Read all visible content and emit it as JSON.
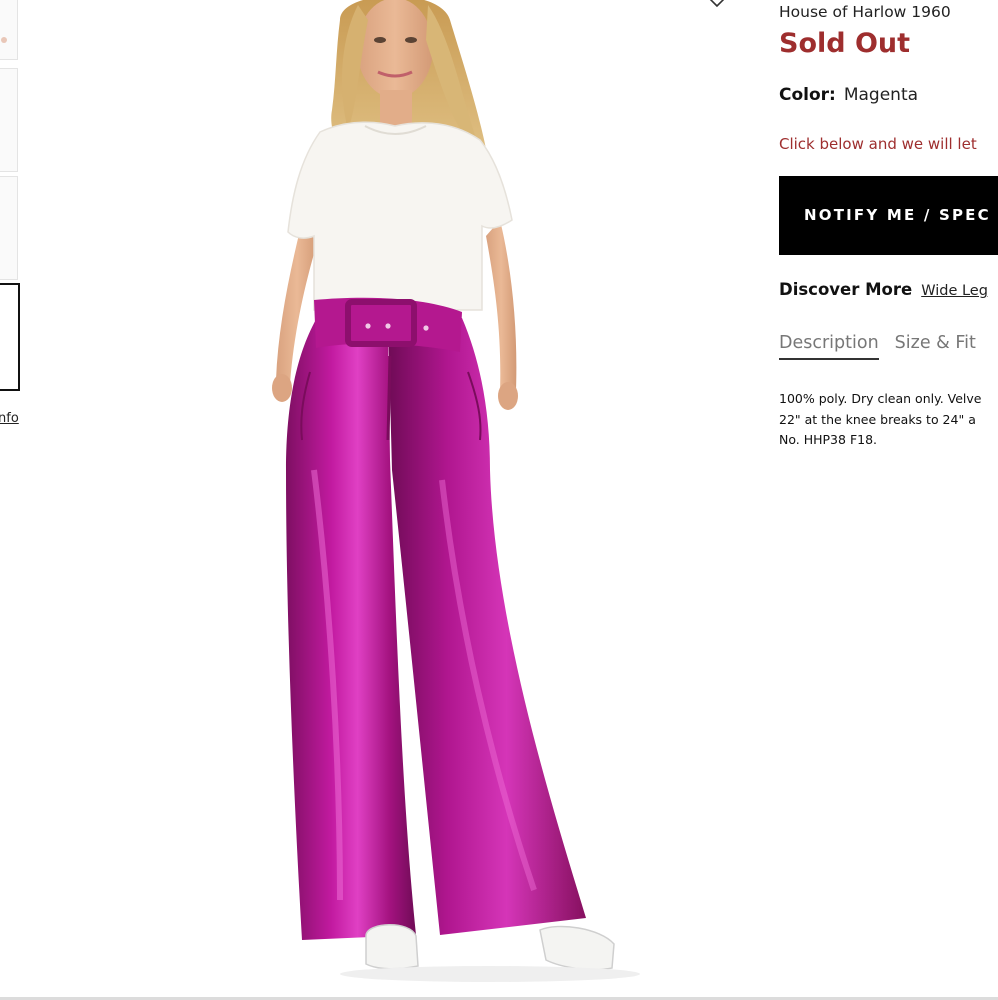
{
  "product": {
    "brand": "House of Harlow 1960",
    "status": "Sold Out",
    "color_label": "Color:",
    "color_value": "Magenta",
    "notice": "Click below and we will let",
    "notify_button": "NOTIFY ME / SPEC",
    "discover_label": "Discover More",
    "discover_link": "Wide Leg",
    "tabs": [
      {
        "label": "Description",
        "active": true
      },
      {
        "label": "Size & Fit",
        "active": false
      }
    ],
    "description_lines": [
      "100% poly. Dry clean only. Velve",
      "22\" at the knee breaks to 24\" a",
      "No. HHP38 F18."
    ]
  },
  "gallery": {
    "size_info_link": "nfo",
    "thumbnail_count": 4,
    "selected_thumbnail": 4
  },
  "icons": {
    "wishlist": "heart-icon"
  },
  "colors": {
    "status_red": "#9e2e2e",
    "button_black": "#000000",
    "pants_magenta": "#a3127f"
  }
}
